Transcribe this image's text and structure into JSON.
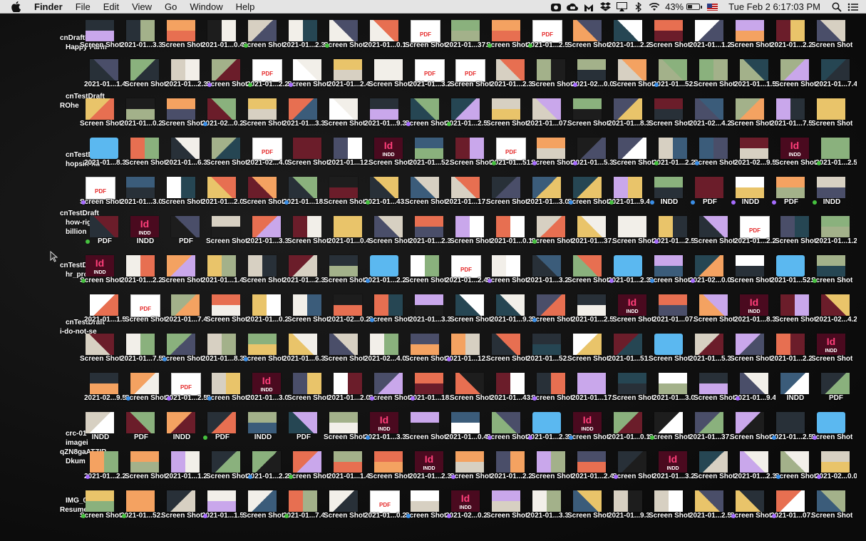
{
  "menubar": {
    "app_name": "Finder",
    "menus": [
      "File",
      "Edit",
      "View",
      "Go",
      "Window",
      "Help"
    ],
    "battery_percent": "43%",
    "battery_level": 0.43,
    "clock": "Tue Feb 2  6:17:03 PM",
    "status_icons": [
      "camera-icon",
      "creative-cloud-icon",
      "malwarebytes-icon",
      "dropbox-icon",
      "airplay-icon",
      "bluetooth-icon",
      "wifi-icon",
      "battery-icon",
      "us-flag-icon",
      "spotlight-icon",
      "notification-center-icon"
    ]
  },
  "desktop": {
    "left_labels": [
      "cnDraftNow",
      "Happy Farm",
      "cnTestDraft",
      "ROhe",
      "cnTestDraft",
      "hopsin-ha",
      "cnTestDraft",
      "how-right",
      "billion",
      "cnTestDraft",
      "hr_product",
      "cnTestDraft",
      "i-do-not-se",
      "crc-01",
      "imagei",
      "qZN8gaATZIR",
      "Dkum",
      "IMG_0670",
      "Resume"
    ],
    "icon_labels": [
      "Screen Shot",
      "2021-01...3.35 AM",
      "Screen Shot",
      "2021-01...0.44 PM",
      "Screen Shot",
      "2021-01...2.31 PM",
      "Screen Shot",
      "2021-01...0.19 PM",
      "Screen Shot",
      "2021-01...37.41 AM",
      "Screen Shot",
      "2021-01...2.54 PM",
      "Screen Shot",
      "2021-01...2.20 AM",
      "Screen Shot",
      "2021-01...1.25 PM",
      "Screen Shot",
      "2021-01...2.23 PM",
      "Screen Shot",
      "2021-01...1.44 PM",
      "Screen Shot",
      "2021-01...2.35 AM",
      "Screen Shot",
      "2021-01...2.23 PM",
      "Screen Shot",
      "2021-01...2.46 PM",
      "Screen Shot",
      "2021-01...3.22 PM",
      "Screen Shot",
      "2021-01...2.34 PM",
      "Screen Shot",
      "2021-02...0.00 AM",
      "Screen Shot",
      "2021-01...52.12 PM",
      "Screen Shot",
      "2021-01...1.54 PM",
      "Screen Shot",
      "2021-01...7.47 AM",
      "Screen Shot",
      "2021-01...0.29 PM",
      "Screen Shot",
      "2021-02...0.28 AM",
      "Screen Shot",
      "2021-01...3.36 PM",
      "Screen Shot",
      "2021-01...9.36 PM",
      "Screen Shot",
      "2021-01...2.59 AM",
      "Screen Shot",
      "2021-01...07.57 PM",
      "Screen Shot",
      "2021-01...8.31 PM",
      "Screen Shot",
      "2021-02...4.26 PM",
      "Screen Shot",
      "2021-01...7.59 PM",
      "Screen Shot",
      "2021-01...8.38 PM",
      "Screen Shot",
      "2021-01...6.38 AM",
      "Screen Shot",
      "2021-02...4.05 PM",
      "Screen Shot",
      "2021-01...12.18 PM",
      "Screen Shot",
      "2021-01...52.17 PM",
      "Screen Shot",
      "2021-01...51.57 PM",
      "Screen Shot",
      "2021-01...5.33 PM",
      "Screen Shot",
      "2021-01...2.27 AM",
      "Screen Shot",
      "2021-02...9.59 AM",
      "Screen Shot",
      "2021-01...2.59 PM",
      "Screen Shot",
      "2021-01...3.07 PM",
      "Screen Shot",
      "2021-01...2.02 PM",
      "Screen Shot",
      "2021-01...18.10 PM",
      "Screen Shot",
      "2021-01...43.12 PM",
      "Screen Shot",
      "2021-01...17.31 PM",
      "Screen Shot",
      "2021-01...3.08 PM",
      "Screen Shot",
      "2021-01...9.44 PM",
      "INDD",
      "PDF",
      "INDD",
      "PDF",
      "INDD",
      "PDF",
      "INDD",
      "PDF"
    ]
  }
}
